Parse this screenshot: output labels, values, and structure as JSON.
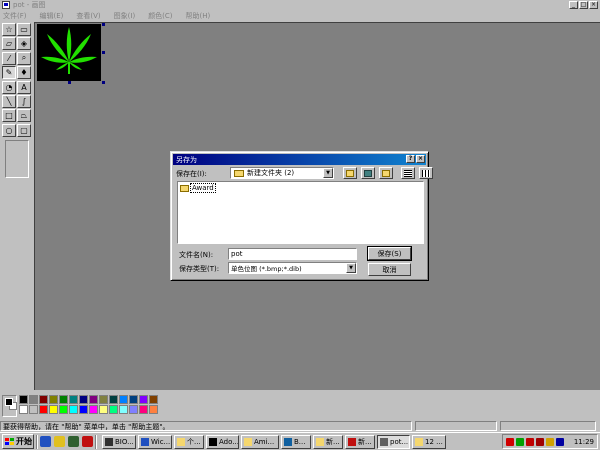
{
  "window": {
    "title": "pot - 画图",
    "controls": [
      "_",
      "□",
      "×"
    ]
  },
  "menu": {
    "items": [
      "文件(F)",
      "编辑(E)",
      "查看(V)",
      "图象(I)",
      "颜色(C)",
      "帮助(H)"
    ]
  },
  "toolbox": {
    "tools": [
      {
        "name": "free-select-tool",
        "glyph": "☆"
      },
      {
        "name": "rect-select-tool",
        "glyph": "▭"
      },
      {
        "name": "eraser-tool",
        "glyph": "▱"
      },
      {
        "name": "fill-tool",
        "glyph": "◈"
      },
      {
        "name": "color-picker-tool",
        "glyph": "⁄"
      },
      {
        "name": "magnifier-tool",
        "glyph": "⌕"
      },
      {
        "name": "pencil-tool",
        "glyph": "✎"
      },
      {
        "name": "brush-tool",
        "glyph": "♦"
      },
      {
        "name": "airbrush-tool",
        "glyph": "◔"
      },
      {
        "name": "text-tool",
        "glyph": "A"
      },
      {
        "name": "line-tool",
        "glyph": "╲"
      },
      {
        "name": "curve-tool",
        "glyph": "∫"
      },
      {
        "name": "rectangle-tool",
        "glyph": "□"
      },
      {
        "name": "polygon-tool",
        "glyph": "⏢"
      },
      {
        "name": "ellipse-tool",
        "glyph": "○"
      },
      {
        "name": "rounded-rect-tool",
        "glyph": "▢"
      }
    ],
    "selected": "pencil-tool"
  },
  "palette": {
    "foreground": "#000000",
    "background": "#ffffff",
    "colors": [
      "#000000",
      "#808080",
      "#800000",
      "#808000",
      "#008000",
      "#008080",
      "#000080",
      "#800080",
      "#808040",
      "#004040",
      "#0080ff",
      "#004080",
      "#8000ff",
      "#804000",
      "#ffffff",
      "#c0c0c0",
      "#ff0000",
      "#ffff00",
      "#00ff00",
      "#00ffff",
      "#0000ff",
      "#ff00ff",
      "#ffff80",
      "#00ff80",
      "#80ffff",
      "#8080ff",
      "#ff0080",
      "#ff8040"
    ]
  },
  "status": {
    "text": "要获得帮助，请在 \"帮助\" 菜单中，单击 \"帮助主题\"。"
  },
  "dialog": {
    "title": "另存为",
    "controls": [
      "?",
      "×"
    ],
    "save_in_label": "保存在(I):",
    "save_in_value": "新建文件夹 (2)",
    "toolbar_icons": [
      "up-folder-icon",
      "desktop-icon",
      "new-folder-icon",
      "list-view-icon",
      "details-view-icon"
    ],
    "folder_item": "Award",
    "filename_label": "文件名(N):",
    "filename_value": "pot",
    "filetype_label": "保存类型(T):",
    "filetype_value": "单色位图 (*.bmp;*.dib)",
    "save_button": "保存(S)",
    "cancel_button": "取消"
  },
  "taskbar": {
    "start_label": "开始",
    "quicklaunch": [
      {
        "name": "ie-icon",
        "color": "#2050c0"
      },
      {
        "name": "outlook-icon",
        "color": "#e0c020"
      },
      {
        "name": "desktop-icon",
        "color": "#306030"
      },
      {
        "name": "acrobat-icon",
        "color": "#c01010"
      }
    ],
    "tasks": [
      {
        "label": "BIO...",
        "icon": "#303030",
        "width": 34
      },
      {
        "label": "Wic...",
        "icon": "#2050c0",
        "width": 34
      },
      {
        "label": "个...",
        "icon": "#f5d76e",
        "width": 30
      },
      {
        "label": "Ado...",
        "icon": "#000000",
        "width": 33
      },
      {
        "label": "Ami...",
        "icon": "#f5d76e",
        "width": 38
      },
      {
        "label": "B...",
        "icon": "#1060a0",
        "width": 30
      },
      {
        "label": "新...",
        "icon": "#f5d76e",
        "width": 30
      },
      {
        "label": "新...",
        "icon": "#c01010",
        "width": 30
      },
      {
        "label": "pot...",
        "icon": "#606060",
        "width": 33,
        "active": true
      },
      {
        "label": "12 ...",
        "icon": "#f5d76e",
        "width": 34
      }
    ],
    "tray": [
      "#d00000",
      "#00a000",
      "#c00000",
      "#a00000",
      "#d0a000",
      "#0000a0"
    ],
    "clock": "11:29"
  }
}
